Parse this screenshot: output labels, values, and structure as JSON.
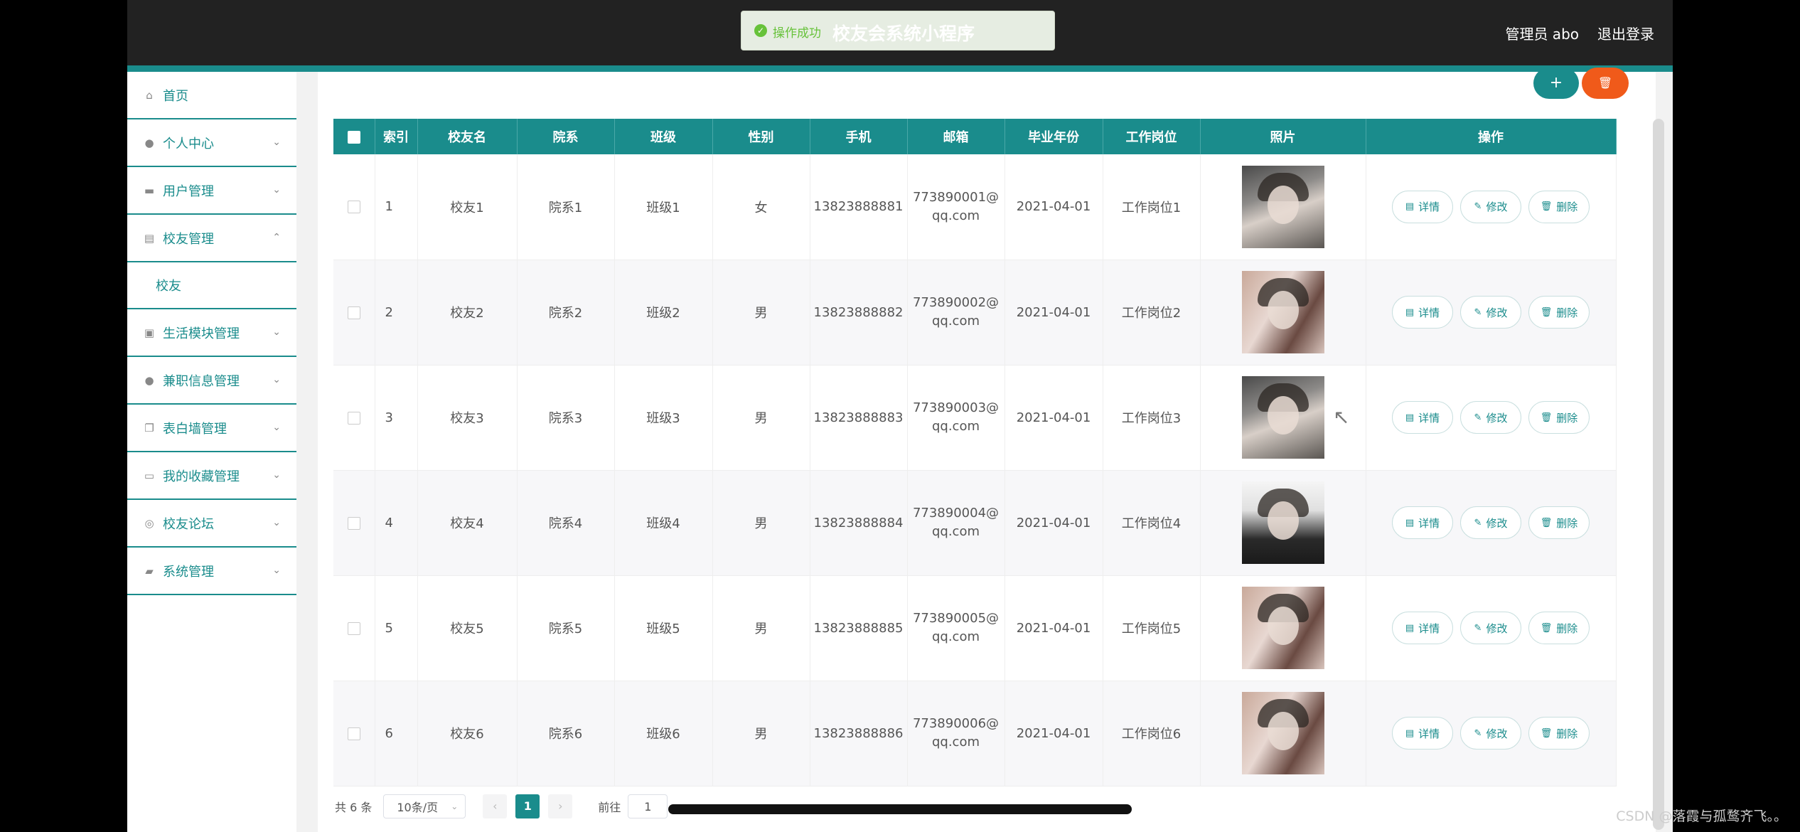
{
  "header": {
    "admin_label": "管理员 abo",
    "logout_label": "退出登录",
    "toast_message": "操作成功",
    "app_title": "校友会系统小程序"
  },
  "sidebar": {
    "items": [
      {
        "label": "首页",
        "icon": "home-icon"
      },
      {
        "label": "个人中心",
        "icon": "user-icon"
      },
      {
        "label": "用户管理",
        "icon": "briefcase-icon"
      },
      {
        "label": "校友管理",
        "icon": "clipboard-icon",
        "expanded": true
      },
      {
        "label": "校友",
        "sub": true
      },
      {
        "label": "生活模块管理",
        "icon": "chart-icon"
      },
      {
        "label": "兼职信息管理",
        "icon": "person-icon"
      },
      {
        "label": "表白墙管理",
        "icon": "copy-icon"
      },
      {
        "label": "我的收藏管理",
        "icon": "message-icon"
      },
      {
        "label": "校友论坛",
        "icon": "compass-icon"
      },
      {
        "label": "系统管理",
        "icon": "ticket-icon"
      }
    ]
  },
  "toolbar": {
    "add_label": "+",
    "delete_label": "🗑"
  },
  "table": {
    "headers": [
      "索引",
      "校友名",
      "院系",
      "班级",
      "性别",
      "手机",
      "邮箱",
      "毕业年份",
      "工作岗位",
      "照片",
      "操作"
    ],
    "rows": [
      {
        "idx": "1",
        "name": "校友1",
        "dept": "院系1",
        "cls": "班级1",
        "gender": "女",
        "phone": "13823888881",
        "email1": "773890001@",
        "email2": "qq.com",
        "year": "2021-04-01",
        "job": "工作岗位1"
      },
      {
        "idx": "2",
        "name": "校友2",
        "dept": "院系2",
        "cls": "班级2",
        "gender": "男",
        "phone": "13823888882",
        "email1": "773890002@",
        "email2": "qq.com",
        "year": "2021-04-01",
        "job": "工作岗位2"
      },
      {
        "idx": "3",
        "name": "校友3",
        "dept": "院系3",
        "cls": "班级3",
        "gender": "男",
        "phone": "13823888883",
        "email1": "773890003@",
        "email2": "qq.com",
        "year": "2021-04-01",
        "job": "工作岗位3"
      },
      {
        "idx": "4",
        "name": "校友4",
        "dept": "院系4",
        "cls": "班级4",
        "gender": "男",
        "phone": "13823888884",
        "email1": "773890004@",
        "email2": "qq.com",
        "year": "2021-04-01",
        "job": "工作岗位4"
      },
      {
        "idx": "5",
        "name": "校友5",
        "dept": "院系5",
        "cls": "班级5",
        "gender": "男",
        "phone": "13823888885",
        "email1": "773890005@",
        "email2": "qq.com",
        "year": "2021-04-01",
        "job": "工作岗位5"
      },
      {
        "idx": "6",
        "name": "校友6",
        "dept": "院系6",
        "cls": "班级6",
        "gender": "男",
        "phone": "13823888886",
        "email1": "773890006@",
        "email2": "qq.com",
        "year": "2021-04-01",
        "job": "工作岗位6"
      }
    ],
    "actions": {
      "detail": "详情",
      "edit": "修改",
      "remove": "删除"
    }
  },
  "pagination": {
    "total": "共 6 条",
    "page_size": "10条/页",
    "current": "1",
    "goto_label": "前往",
    "goto_value": "1"
  },
  "watermark": "CSDN @落霞与孤鹜齐飞。。",
  "colors": {
    "primary": "#1a8c8c",
    "danger": "#f05a1a",
    "header": "#222222",
    "success": "#67c23a"
  }
}
